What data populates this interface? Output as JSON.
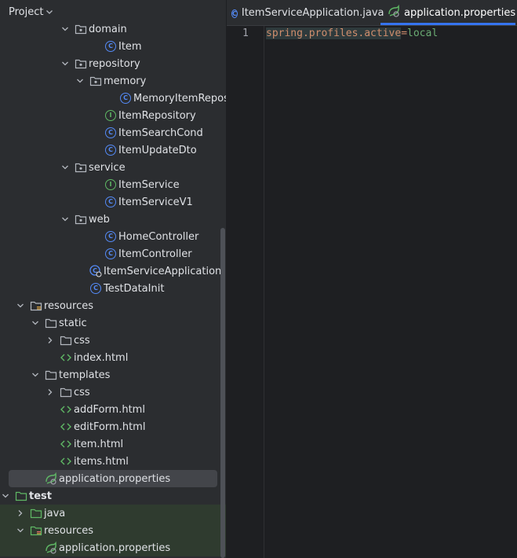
{
  "project_panel": {
    "title": "Project",
    "tree": [
      {
        "label": "domain",
        "icon": "package-folder-icon",
        "chevron": "down",
        "indent": 76
      },
      {
        "label": "Item",
        "icon": "class-icon",
        "chevron": "none",
        "indent": 114
      },
      {
        "label": "repository",
        "icon": "package-folder-icon",
        "chevron": "down",
        "indent": 76
      },
      {
        "label": "memory",
        "icon": "package-folder-icon",
        "chevron": "down",
        "indent": 95
      },
      {
        "label": "MemoryItemRepository",
        "icon": "class-icon",
        "chevron": "none",
        "indent": 133
      },
      {
        "label": "ItemRepository",
        "icon": "interface-icon",
        "chevron": "none",
        "indent": 114
      },
      {
        "label": "ItemSearchCond",
        "icon": "class-icon",
        "chevron": "none",
        "indent": 114
      },
      {
        "label": "ItemUpdateDto",
        "icon": "class-icon",
        "chevron": "none",
        "indent": 114
      },
      {
        "label": "service",
        "icon": "package-folder-icon",
        "chevron": "down",
        "indent": 76
      },
      {
        "label": "ItemService",
        "icon": "interface-icon",
        "chevron": "none",
        "indent": 114
      },
      {
        "label": "ItemServiceV1",
        "icon": "class-icon",
        "chevron": "none",
        "indent": 114
      },
      {
        "label": "web",
        "icon": "package-folder-icon",
        "chevron": "down",
        "indent": 76
      },
      {
        "label": "HomeController",
        "icon": "class-icon",
        "chevron": "none",
        "indent": 114
      },
      {
        "label": "ItemController",
        "icon": "class-icon",
        "chevron": "none",
        "indent": 114
      },
      {
        "label": "ItemServiceApplication",
        "icon": "spring-boot-class-icon",
        "chevron": "none",
        "indent": 95
      },
      {
        "label": "TestDataInit",
        "icon": "class-icon",
        "chevron": "none",
        "indent": 95
      },
      {
        "label": "resources",
        "icon": "resources-folder-icon",
        "chevron": "down",
        "indent": 19
      },
      {
        "label": "static",
        "icon": "folder-icon",
        "chevron": "down",
        "indent": 38
      },
      {
        "label": "css",
        "icon": "folder-icon",
        "chevron": "right",
        "indent": 57
      },
      {
        "label": "index.html",
        "icon": "html-file-icon",
        "chevron": "none",
        "indent": 57
      },
      {
        "label": "templates",
        "icon": "folder-icon",
        "chevron": "down",
        "indent": 38
      },
      {
        "label": "css",
        "icon": "folder-icon",
        "chevron": "right",
        "indent": 57
      },
      {
        "label": "addForm.html",
        "icon": "html-file-icon",
        "chevron": "none",
        "indent": 57
      },
      {
        "label": "editForm.html",
        "icon": "html-file-icon",
        "chevron": "none",
        "indent": 57
      },
      {
        "label": "item.html",
        "icon": "html-file-icon",
        "chevron": "none",
        "indent": 57
      },
      {
        "label": "items.html",
        "icon": "html-file-icon",
        "chevron": "none",
        "indent": 57
      },
      {
        "label": "application.properties",
        "icon": "spring-properties-icon",
        "chevron": "none",
        "indent": 38,
        "selected": true
      },
      {
        "label": "test",
        "icon": "test-folder-icon",
        "chevron": "down",
        "indent": 0
      },
      {
        "label": "java",
        "icon": "test-folder-icon",
        "chevron": "right",
        "indent": 19,
        "green": true
      },
      {
        "label": "resources",
        "icon": "test-resources-folder-icon",
        "chevron": "down",
        "indent": 19,
        "green": true
      },
      {
        "label": "application.properties",
        "icon": "spring-properties-icon",
        "chevron": "none",
        "indent": 38,
        "green": true
      }
    ]
  },
  "editor": {
    "tabs": [
      {
        "label": "ItemServiceApplication.java",
        "icon": "class-icon",
        "active": false
      },
      {
        "label": "application.properties",
        "icon": "spring-properties-icon",
        "active": true
      }
    ],
    "close_glyph": "×",
    "line_number": "1",
    "code": {
      "key": "spring.profiles.active",
      "eq": "=",
      "value": "local"
    }
  },
  "colors": {
    "accent": "#3574f0",
    "class_icon": "#548af7",
    "interface_icon": "#5fb865",
    "keyword": "#cf8e6d",
    "string": "#6aab73"
  }
}
